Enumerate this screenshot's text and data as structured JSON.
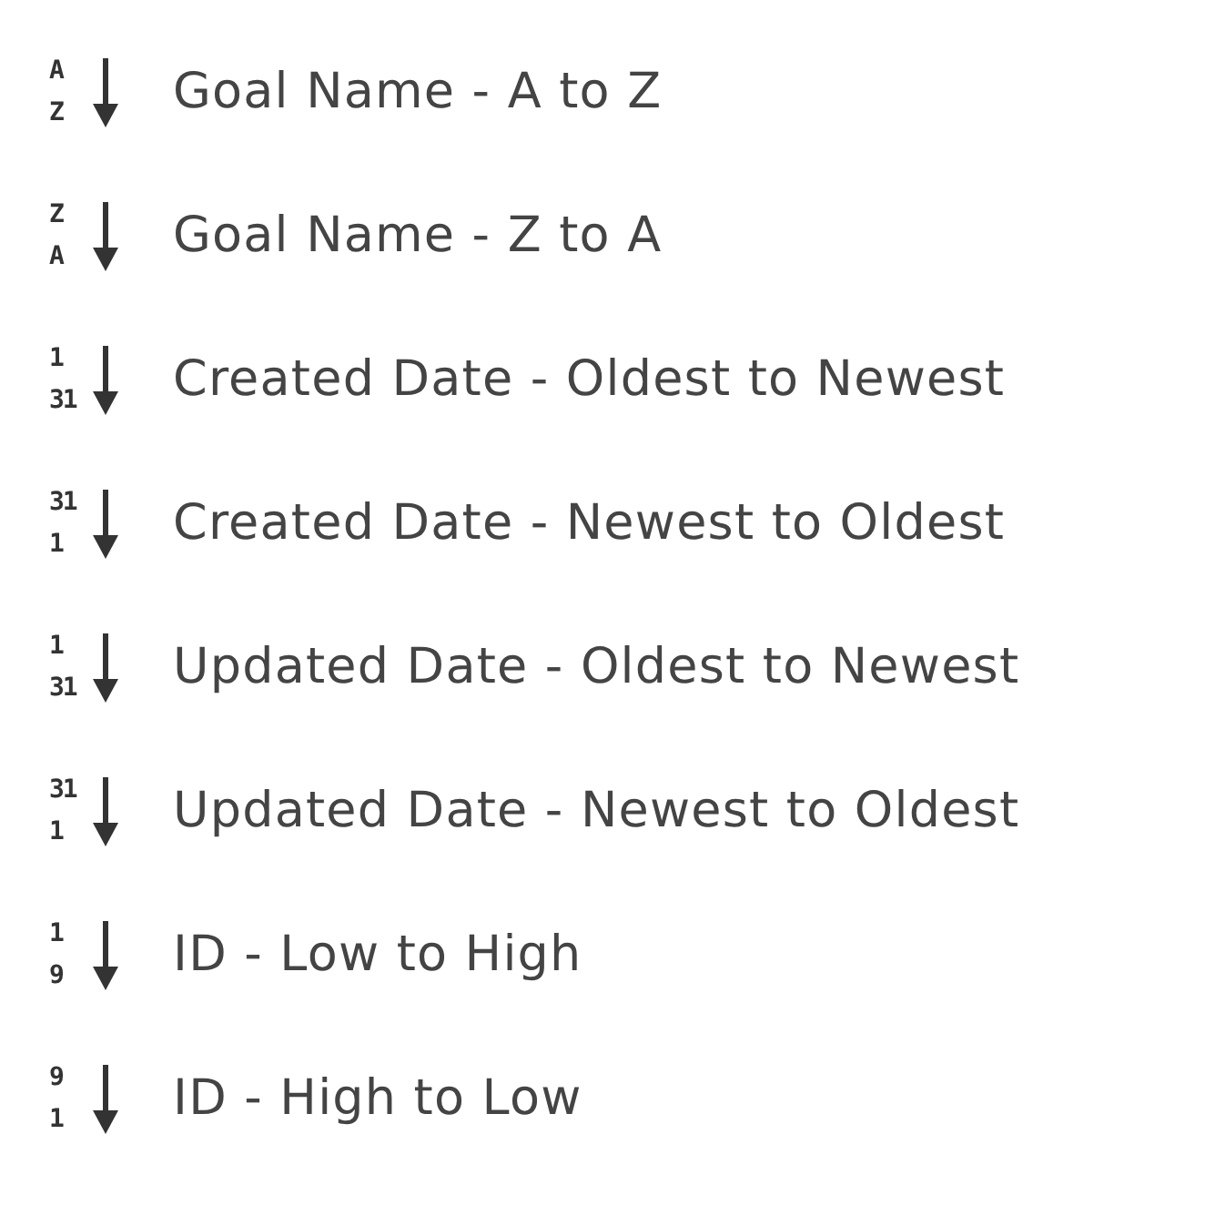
{
  "sort_options": [
    {
      "icon_text": [
        "A",
        "Z"
      ],
      "label": "Goal Name - A to Z"
    },
    {
      "icon_text": [
        "Z",
        "A"
      ],
      "label": "Goal Name - Z to A"
    },
    {
      "icon_text": [
        "1",
        "31"
      ],
      "label": "Created Date - Oldest to Newest"
    },
    {
      "icon_text": [
        "31",
        "1"
      ],
      "label": "Created Date - Newest to Oldest"
    },
    {
      "icon_text": [
        "1",
        "31"
      ],
      "label": "Updated Date - Oldest to Newest"
    },
    {
      "icon_text": [
        "31",
        "1"
      ],
      "label": "Updated Date - Newest to Oldest"
    },
    {
      "icon_text": [
        "1",
        "9"
      ],
      "label": "ID - Low to High"
    },
    {
      "icon_text": [
        "9",
        "1"
      ],
      "label": "ID - High to Low"
    }
  ]
}
